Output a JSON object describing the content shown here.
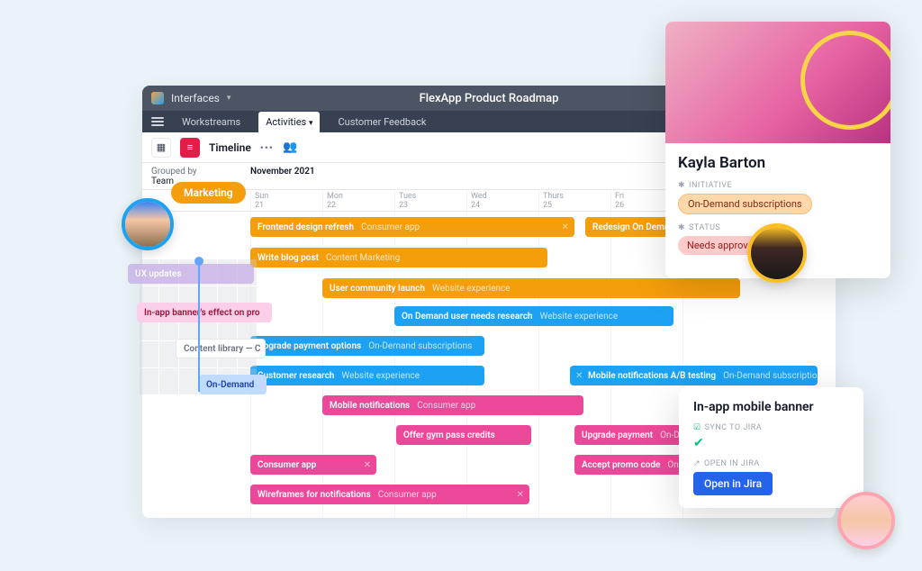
{
  "header": {
    "breadcrumb": "Interfaces",
    "title": "FlexApp Product Roadmap"
  },
  "tabs": {
    "workstreams": "Workstreams",
    "activities": "Activities",
    "feedback": "Customer Feedback"
  },
  "viewbar": {
    "timeline": "Timeline"
  },
  "group": {
    "label": "Grouped by",
    "value": "Team",
    "month": "November 2021"
  },
  "days": [
    {
      "dow": "Sun",
      "num": "21"
    },
    {
      "dow": "Mon",
      "num": "22"
    },
    {
      "dow": "Tues",
      "num": "23"
    },
    {
      "dow": "Wed",
      "num": "24"
    },
    {
      "dow": "Thurs",
      "num": "25"
    },
    {
      "dow": "Fri",
      "num": "26"
    }
  ],
  "bars": {
    "frontend": {
      "label": "Frontend design refresh",
      "sub": "Consumer app"
    },
    "redesign": {
      "label": "Redesign On Demand offer",
      "sub": ""
    },
    "blog": {
      "label": "Write blog post",
      "sub": "Content Marketing"
    },
    "community": {
      "label": "User community launch",
      "sub": "Website experience"
    },
    "research": {
      "label": "On Demand user needs research",
      "sub": "Website experience"
    },
    "upgrade": {
      "label": "Upgrade payment options",
      "sub": "On-Demand subscriptions"
    },
    "customer": {
      "label": "Customer research",
      "sub": "Website experience"
    },
    "abtest": {
      "label": "Mobile notifications A/B testing",
      "sub": "On-Demand subscriptions"
    },
    "mobilen": {
      "label": "Mobile notifications",
      "sub": "Consumer app"
    },
    "gympass": {
      "label": "Offer gym pass credits",
      "sub": ""
    },
    "upgpay": {
      "label": "Upgrade payment",
      "sub": "On-Demand"
    },
    "consumer": {
      "label": "Consumer app",
      "sub": ""
    },
    "promo": {
      "label": "Accept promo code",
      "sub": "On-Demand"
    },
    "wireframes": {
      "label": "Wireframes for notifications",
      "sub": "Consumer app"
    },
    "ux": {
      "label": "UX updates",
      "sub": ""
    },
    "inapp": {
      "label": "In-app banner's effect on pro",
      "sub": ""
    },
    "contentlib": {
      "label": "Content library — C",
      "sub": ""
    },
    "ondemand": {
      "label": "On-Demand",
      "sub": ""
    }
  },
  "marketing": "Marketing",
  "profile": {
    "name": "Kayla Barton",
    "initiative_label": "INITIATIVE",
    "initiative_value": "On-Demand subscriptions",
    "status_label": "STATUS",
    "status_value": "Needs approval"
  },
  "jira": {
    "title": "In-app mobile banner",
    "sync_label": "SYNC TO JIRA",
    "open_label": "OPEN IN JIRA",
    "button": "Open in Jira"
  }
}
